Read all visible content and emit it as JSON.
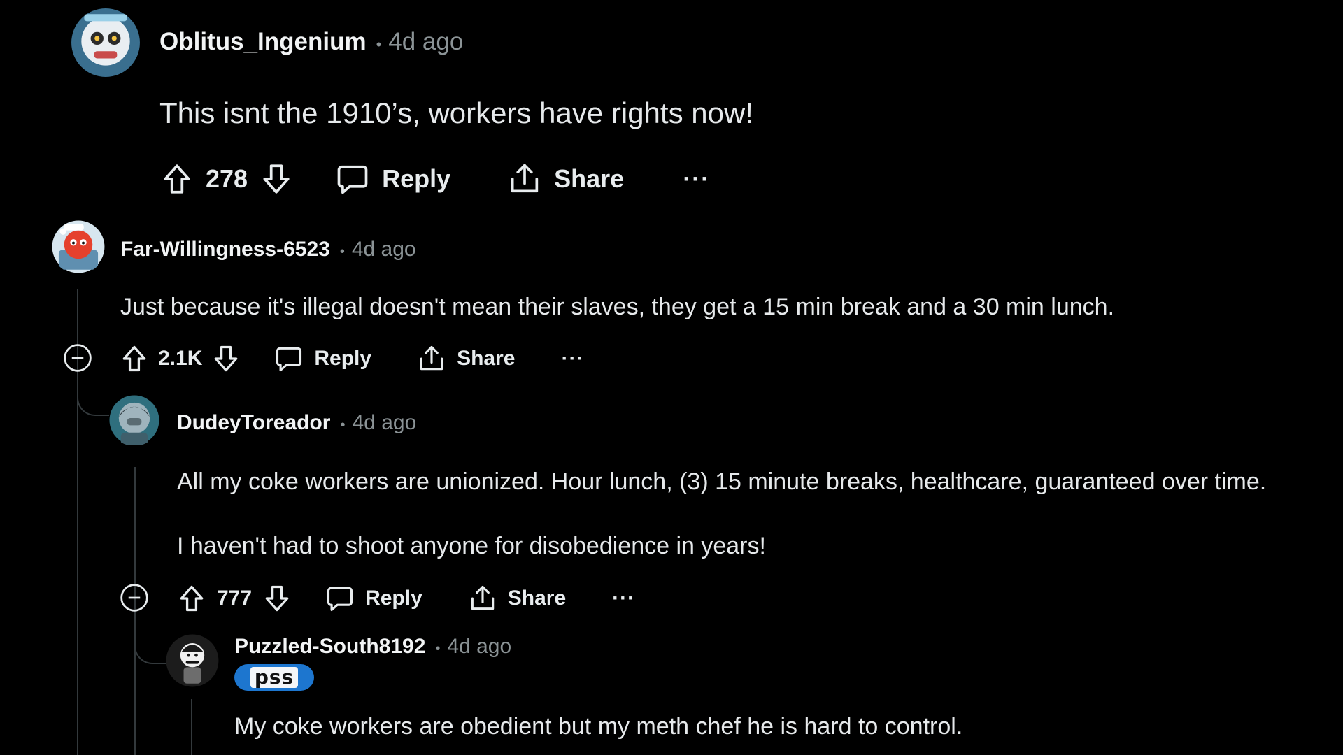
{
  "colors": {
    "background": "#000000",
    "text": "#e8ecee",
    "muted": "#8b9396",
    "thread_line": "#33393c",
    "flair_bg": "#1d76cf"
  },
  "icons": {
    "upvote": "arrow-up-icon",
    "downvote": "arrow-down-icon",
    "reply": "speech-bubble-icon",
    "share": "share-upload-icon",
    "more": "ellipsis-icon",
    "collapse": "minus-circle-icon"
  },
  "comments": [
    {
      "username": "Oblitus_Ingenium",
      "dot": "•",
      "time": "4d ago",
      "body": [
        "This isnt the 1910’s, workers have rights now!"
      ],
      "votes": "278",
      "reply_label": "Reply",
      "share_label": "Share",
      "more_label": "···"
    },
    {
      "username": "Far-Willingness-6523",
      "dot": "•",
      "time": "4d ago",
      "body": [
        "Just because it's illegal doesn't mean their slaves, they get a 15 min break and a 30 min lunch."
      ],
      "votes": "2.1K",
      "reply_label": "Reply",
      "share_label": "Share",
      "more_label": "···"
    },
    {
      "username": "DudeyToreador",
      "dot": "•",
      "time": "4d ago",
      "body": [
        "All my coke workers are unionized. Hour lunch, (3) 15 minute breaks, healthcare, guaranteed over time.",
        "I haven't had to shoot anyone for disobedience in years!"
      ],
      "votes": "777",
      "reply_label": "Reply",
      "share_label": "Share",
      "more_label": "···"
    },
    {
      "username": "Puzzled-South8192",
      "dot": "•",
      "time": "4d ago",
      "flair": "pss",
      "body": [
        "My coke workers are obedient but my meth chef he is hard to control."
      ]
    }
  ]
}
